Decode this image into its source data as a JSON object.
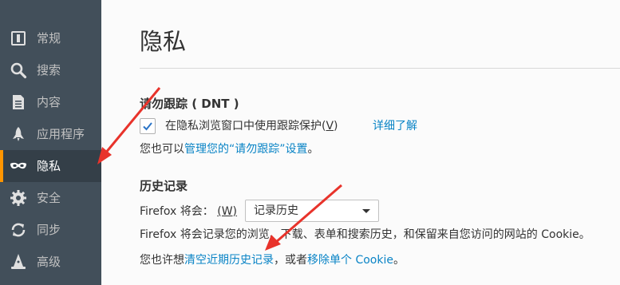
{
  "sidebar": {
    "items": [
      {
        "label": "常规",
        "icon": "general-icon"
      },
      {
        "label": "搜索",
        "icon": "search-icon"
      },
      {
        "label": "内容",
        "icon": "content-icon"
      },
      {
        "label": "应用程序",
        "icon": "rocket-icon"
      },
      {
        "label": "隐私",
        "icon": "mask-icon",
        "selected": true
      },
      {
        "label": "安全",
        "icon": "gear-icon"
      },
      {
        "label": "同步",
        "icon": "sync-icon"
      },
      {
        "label": "高级",
        "icon": "wizard-hat-icon"
      }
    ]
  },
  "page": {
    "title": "隐私"
  },
  "dnt": {
    "heading": "请勿跟踪 ( DNT )",
    "checkbox_checked": true,
    "checkbox_label": "在隐私浏览窗口中使用跟踪保护(",
    "checkbox_accesskey": "V",
    "checkbox_label_end": ")",
    "learn_more": "详细了解",
    "manage_prefix": "您也可以",
    "manage_link": "管理您的“请勿跟踪”设置",
    "manage_suffix": "。"
  },
  "history": {
    "heading": "历史记录",
    "will_label": "Firefox 将会：",
    "will_accesskey": "(W)",
    "select_value": "记录历史",
    "description": "Firefox 将会记录您的浏览、下载、表单和搜索历史，和保留来自您访问的网站的 Cookie。",
    "clear_prefix": "您也许想",
    "clear_link": "清空近期历史记录",
    "clear_middle": "，或者",
    "remove_link": "移除单个 Cookie",
    "clear_suffix": "。"
  },
  "colors": {
    "sidebar_bg": "#424f5a",
    "selected_bg": "#343f48",
    "selected_accent": "#ff9500",
    "link": "#0a84c6",
    "annotation_arrow": "#e8332b"
  }
}
